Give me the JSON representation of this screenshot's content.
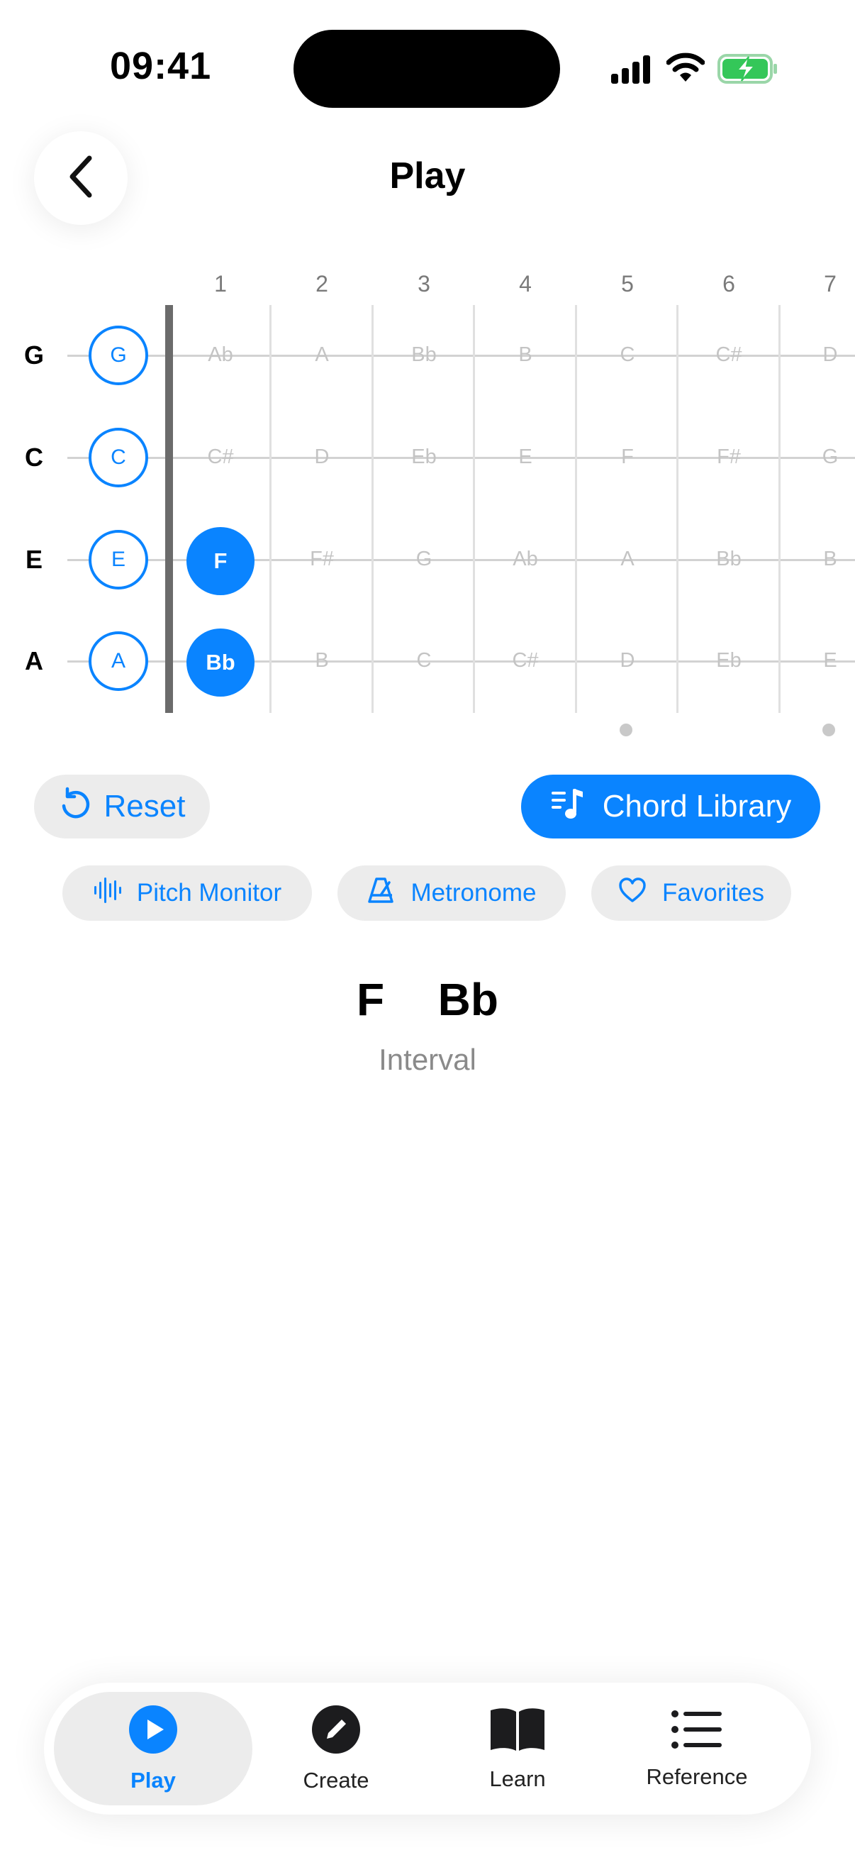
{
  "status_bar": {
    "time": "09:41"
  },
  "header": {
    "title": "Play"
  },
  "fretboard": {
    "fret_numbers": [
      "1",
      "2",
      "3",
      "4",
      "5",
      "6",
      "7"
    ],
    "strings": [
      {
        "name": "G",
        "open": "G",
        "frets": [
          "Ab",
          "A",
          "Bb",
          "B",
          "C",
          "C#",
          "D"
        ]
      },
      {
        "name": "C",
        "open": "C",
        "frets": [
          "C#",
          "D",
          "Eb",
          "E",
          "F",
          "F#",
          "G"
        ]
      },
      {
        "name": "E",
        "open": "E",
        "frets": [
          "F",
          "F#",
          "G",
          "Ab",
          "A",
          "Bb",
          "B"
        ]
      },
      {
        "name": "A",
        "open": "A",
        "frets": [
          "Bb",
          "B",
          "C",
          "C#",
          "D",
          "Eb",
          "E"
        ]
      }
    ],
    "selected": [
      {
        "string": "E",
        "fret": 1,
        "note": "F"
      },
      {
        "string": "A",
        "fret": 1,
        "note": "Bb"
      }
    ],
    "marker_frets": [
      5,
      7
    ]
  },
  "actions": {
    "reset_label": "Reset",
    "chord_library_label": "Chord Library",
    "pitch_monitor_label": "Pitch Monitor",
    "metronome_label": "Metronome",
    "favorites_label": "Favorites"
  },
  "chord": {
    "name": "F  Bb",
    "type": "Interval"
  },
  "tabs": {
    "play": "Play",
    "create": "Create",
    "learn": "Learn",
    "reference": "Reference",
    "active": "Play"
  },
  "colors": {
    "accent": "#0a84ff",
    "battery": "#34c759"
  },
  "icons": [
    "back-chevron-icon",
    "signal-icon",
    "wifi-icon",
    "battery-charging-icon",
    "reset-icon",
    "chord-library-icon",
    "pitch-monitor-icon",
    "metronome-icon",
    "heart-icon",
    "play-icon",
    "pencil-icon",
    "book-icon",
    "list-icon"
  ]
}
